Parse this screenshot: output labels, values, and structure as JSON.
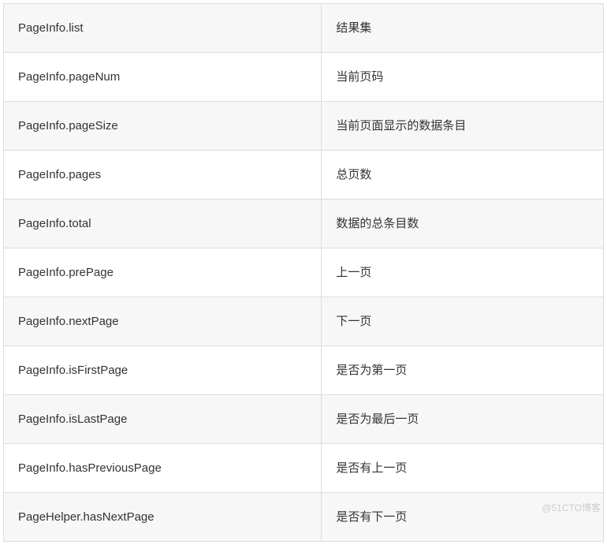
{
  "table": {
    "rows": [
      {
        "property": "PageInfo.list",
        "description": "结果集"
      },
      {
        "property": "PageInfo.pageNum",
        "description": "当前页码"
      },
      {
        "property": "PageInfo.pageSize",
        "description": "当前页面显示的数据条目"
      },
      {
        "property": "PageInfo.pages",
        "description": "总页数"
      },
      {
        "property": "PageInfo.total",
        "description": "数据的总条目数"
      },
      {
        "property": "PageInfo.prePage",
        "description": "上一页"
      },
      {
        "property": "PageInfo.nextPage",
        "description": "下一页"
      },
      {
        "property": "PageInfo.isFirstPage",
        "description": "是否为第一页"
      },
      {
        "property": "PageInfo.isLastPage",
        "description": "是否为最后一页"
      },
      {
        "property": "PageInfo.hasPreviousPage",
        "description": "是否有上一页"
      },
      {
        "property": "PageHelper.hasNextPage",
        "description": "是否有下一页"
      }
    ]
  },
  "watermark": "@51CTO博客"
}
